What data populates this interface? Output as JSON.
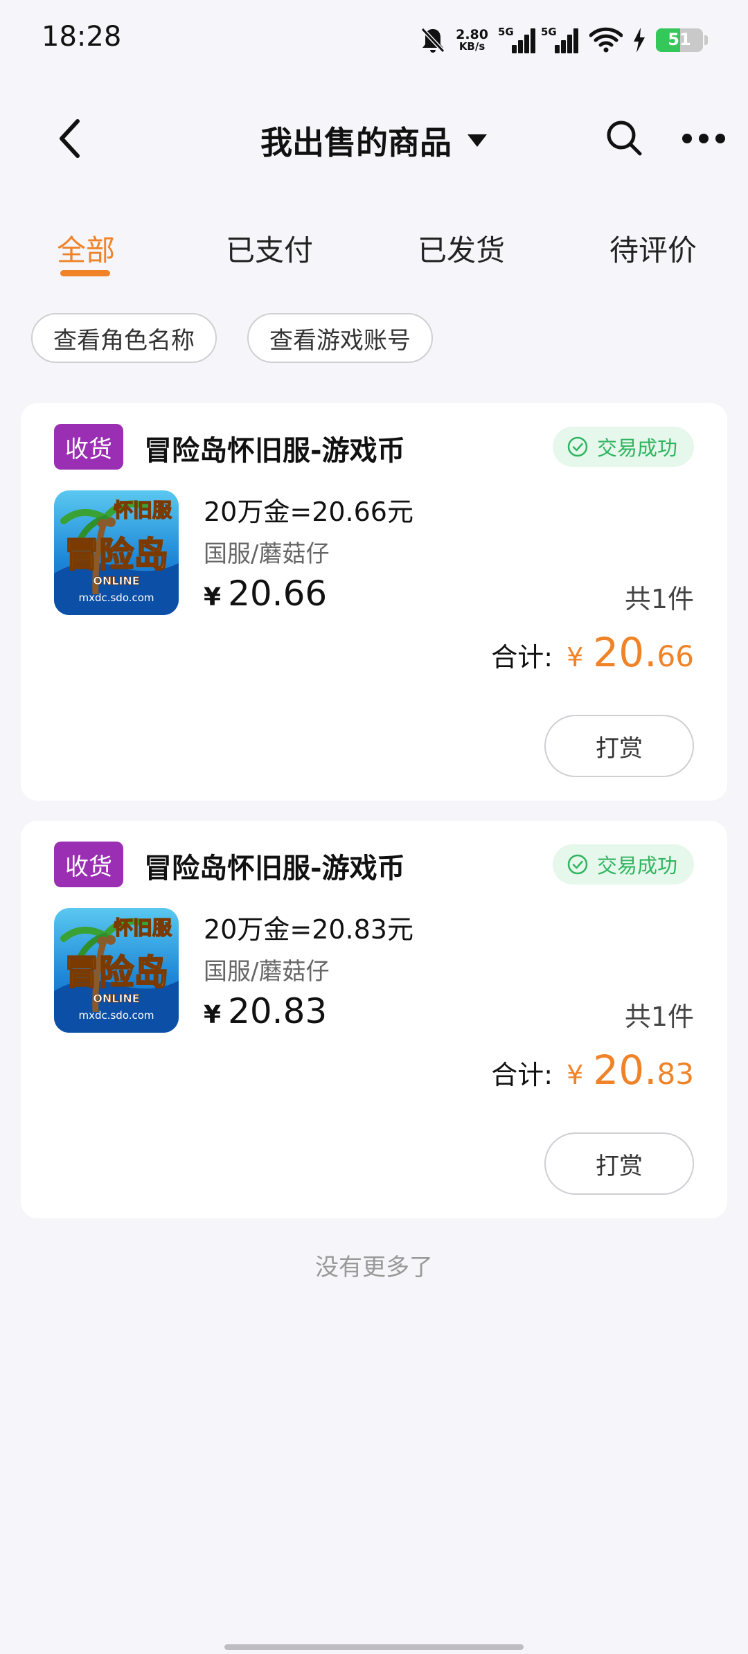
{
  "status_bar": {
    "time": "18:28",
    "net_speed_value": "2.80",
    "net_speed_unit": "KB/s",
    "sim1_label": "5G",
    "sim2_label": "5G",
    "battery": "51",
    "battery_level": 0.51,
    "icons": [
      "bell-muted-icon",
      "signal-icon",
      "wifi-icon",
      "charging-icon",
      "battery-icon"
    ]
  },
  "header": {
    "title": "我出售的商品",
    "icons": [
      "back-icon",
      "dropdown-triangle-icon",
      "search-icon",
      "more-icon"
    ]
  },
  "tabs": [
    {
      "label": "全部",
      "active": true
    },
    {
      "label": "已支付",
      "active": false
    },
    {
      "label": "已发货",
      "active": false
    },
    {
      "label": "待评价",
      "active": false
    }
  ],
  "filters": [
    "查看角色名称",
    "查看游戏账号"
  ],
  "orders": [
    {
      "badge": "收货",
      "title": "冒险岛怀旧服-游戏币",
      "status": "交易成功",
      "item_name": "20万金=20.66元",
      "server": "国服/蘑菇仔",
      "currency": "¥",
      "price": "20.66",
      "quantity": "共1件",
      "total_label": "合计:",
      "total_currency": "¥",
      "total_int": "20.",
      "total_dec": "66",
      "action": "打赏",
      "icon_text_top": "怀旧服",
      "icon_text_main": "冒险岛",
      "icon_text_online": "ONLINE",
      "icon_text_url": "mxdc.sdo.com"
    },
    {
      "badge": "收货",
      "title": "冒险岛怀旧服-游戏币",
      "status": "交易成功",
      "item_name": "20万金=20.83元",
      "server": "国服/蘑菇仔",
      "currency": "¥",
      "price": "20.83",
      "quantity": "共1件",
      "total_label": "合计:",
      "total_currency": "¥",
      "total_int": "20.",
      "total_dec": "83",
      "action": "打赏",
      "icon_text_top": "怀旧服",
      "icon_text_main": "冒险岛",
      "icon_text_online": "ONLINE",
      "icon_text_url": "mxdc.sdo.com"
    }
  ],
  "footer_text": "没有更多了",
  "colors": {
    "accent": "#f08328",
    "badge": "#9b2fb3",
    "success": "#2fb560",
    "success_bg": "#e6f7ec",
    "background": "#f5f5fa"
  }
}
